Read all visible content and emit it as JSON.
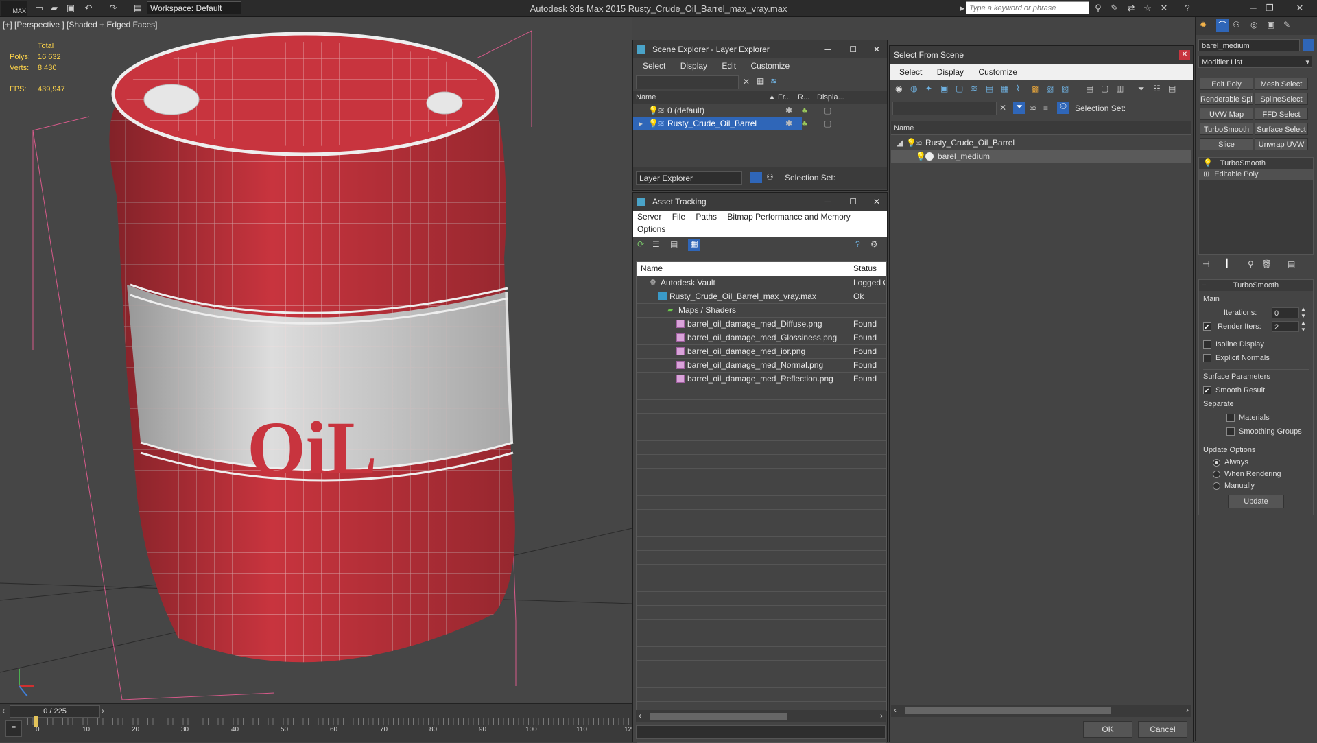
{
  "app": {
    "logo_text": "MAX",
    "title": "Autodesk 3ds Max  2015      Rusty_Crude_Oil_Barrel_max_vray.max",
    "workspace": "Workspace: Default",
    "search_placeholder": "Type a keyword or phrase"
  },
  "viewport": {
    "label": "[+] [Perspective ] [Shaded + Edged Faces]",
    "stats": {
      "total_label": "Total",
      "polys_label": "Polys:",
      "polys": "16 632",
      "verts_label": "Verts:",
      "verts": "8 430",
      "fps_label": "FPS:",
      "fps": "439,947"
    },
    "barrel_text": "OiL"
  },
  "timeline": {
    "frame": "0 / 225",
    "ticks": [
      "0",
      "10",
      "20",
      "30",
      "40",
      "50",
      "60",
      "70",
      "80",
      "90",
      "100",
      "110",
      "12"
    ]
  },
  "scene_explorer": {
    "title": "Scene Explorer - Layer Explorer",
    "menu": [
      "Select",
      "Display",
      "Edit",
      "Customize"
    ],
    "columns": [
      "Name",
      "Fr...",
      "R...",
      "Displa..."
    ],
    "rows": [
      {
        "name": "0 (default)"
      },
      {
        "name": "Rusty_Crude_Oil_Barrel"
      }
    ],
    "footer_dropdown": "Layer Explorer",
    "selection_set": "Selection Set:"
  },
  "asset_tracking": {
    "title": "Asset Tracking",
    "menu1": [
      "Server",
      "File",
      "Paths",
      "Bitmap Performance and Memory"
    ],
    "menu2": [
      "Options"
    ],
    "columns": [
      "Name",
      "Status"
    ],
    "rows": [
      {
        "name": "Autodesk Vault",
        "status": "Logged O",
        "indent": 1
      },
      {
        "name": "Rusty_Crude_Oil_Barrel_max_vray.max",
        "status": "Ok",
        "indent": 2
      },
      {
        "name": "Maps / Shaders",
        "status": "",
        "indent": 3
      },
      {
        "name": "barrel_oil_damage_med_Diffuse.png",
        "status": "Found",
        "indent": 4
      },
      {
        "name": "barrel_oil_damage_med_Glossiness.png",
        "status": "Found",
        "indent": 4
      },
      {
        "name": "barrel_oil_damage_med_ior.png",
        "status": "Found",
        "indent": 4
      },
      {
        "name": "barrel_oil_damage_med_Normal.png",
        "status": "Found",
        "indent": 4
      },
      {
        "name": "barrel_oil_damage_med_Reflection.png",
        "status": "Found",
        "indent": 4
      }
    ]
  },
  "select_from_scene": {
    "title": "Select From Scene",
    "menu": [
      "Select",
      "Display",
      "Customize"
    ],
    "selection_set": "Selection Set:",
    "column": "Name",
    "tree": [
      {
        "name": "Rusty_Crude_Oil_Barrel"
      },
      {
        "name": "barel_medium"
      }
    ],
    "ok": "OK",
    "cancel": "Cancel"
  },
  "command_panel": {
    "object_name": "barel_medium",
    "modifier_list": "Modifier List",
    "buttons": [
      "Edit Poly",
      "Mesh Select",
      "Renderable Spline",
      "SplineSelect",
      "UVW Map",
      "FFD Select",
      "TurboSmooth",
      "Surface Select",
      "Slice",
      "Unwrap UVW"
    ],
    "stack": [
      "TurboSmooth",
      "Editable Poly"
    ],
    "rollout_title": "TurboSmooth",
    "main_label": "Main",
    "iterations_label": "Iterations:",
    "iterations": "0",
    "render_iters_label": "Render Iters:",
    "render_iters": "2",
    "isoline": "Isoline Display",
    "explicit_normals": "Explicit Normals",
    "surface_params": "Surface Parameters",
    "smooth_result": "Smooth Result",
    "separate": "Separate",
    "materials": "Materials",
    "smoothing_groups": "Smoothing Groups",
    "update_options": "Update Options",
    "always": "Always",
    "when_rendering": "When Rendering",
    "manually": "Manually",
    "update_btn": "Update"
  }
}
